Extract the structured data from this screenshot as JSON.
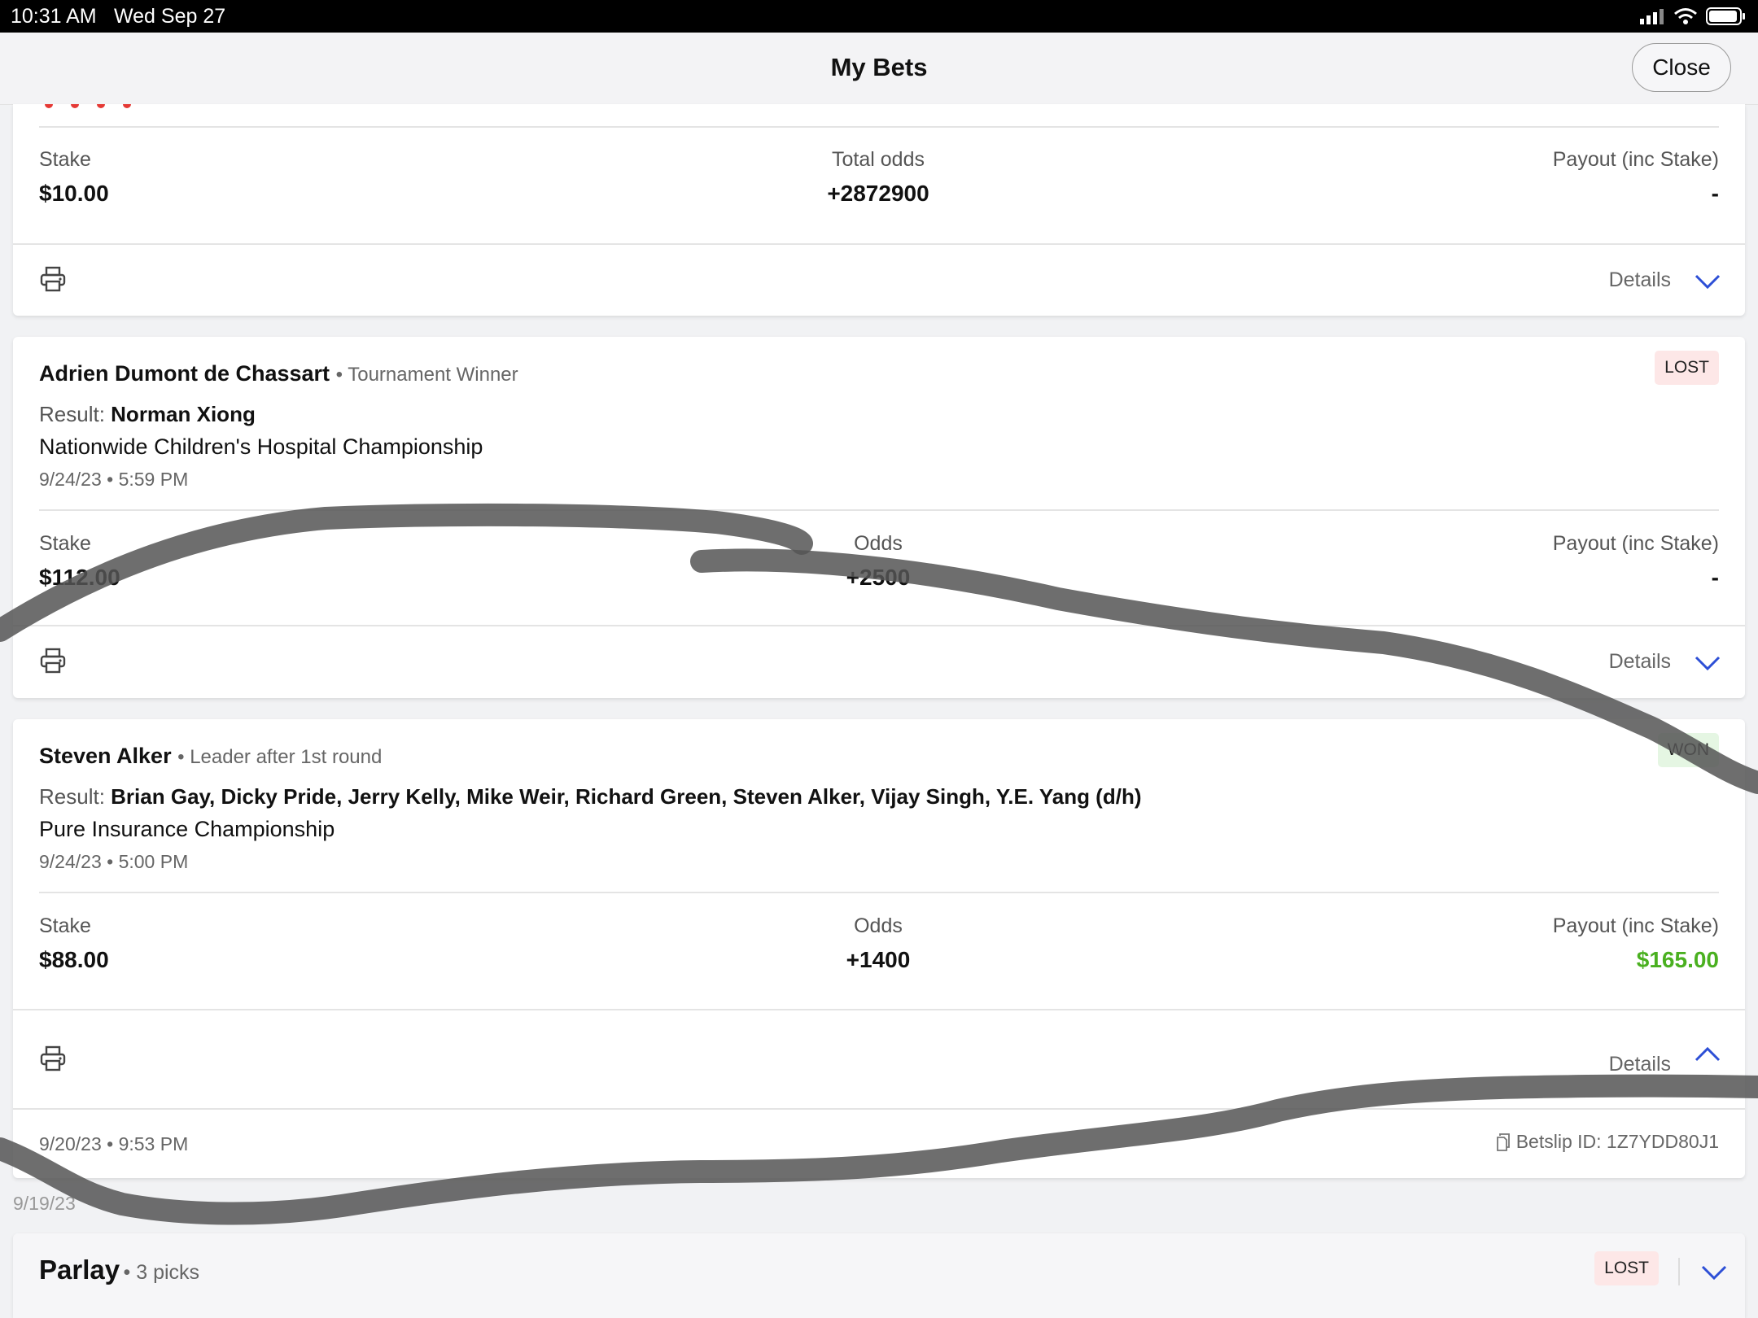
{
  "status_bar": {
    "time": "10:31 AM",
    "date": "Wed Sep 27"
  },
  "header": {
    "title": "My Bets",
    "close_label": "Close"
  },
  "card_top": {
    "stake_label": "Stake",
    "stake_value": "$10.00",
    "odds_label": "Total odds",
    "odds_value": "+2872900",
    "payout_label": "Payout (inc Stake)",
    "payout_value": "-",
    "details_label": "Details"
  },
  "bets": [
    {
      "selection": "Adrien Dumont de Chassart",
      "market": "Tournament Winner",
      "status": "LOST",
      "result_label": "Result:",
      "result_value": "Norman Xiong",
      "event": "Nationwide Children's Hospital Championship",
      "datetime": "9/24/23 • 5:59 PM",
      "stake_label": "Stake",
      "stake_value": "$112.00",
      "odds_label": "Odds",
      "odds_value": "+2500",
      "payout_label": "Payout (inc Stake)",
      "payout_value": "-",
      "details_label": "Details"
    },
    {
      "selection": "Steven Alker",
      "market": "Leader after 1st round",
      "status": "WON",
      "result_label": "Result:",
      "result_value": "Brian Gay, Dicky Pride, Jerry Kelly, Mike Weir, Richard Green, Steven Alker, Vijay Singh, Y.E. Yang (d/h)",
      "event": "Pure Insurance Championship",
      "datetime": "9/24/23 • 5:00 PM",
      "stake_label": "Stake",
      "stake_value": "$88.00",
      "odds_label": "Odds",
      "odds_value": "+1400",
      "payout_label": "Payout (inc Stake)",
      "payout_value": "$165.00",
      "details_label": "Details",
      "placed_datetime": "9/20/23 • 9:53 PM",
      "betslip_label": "Betslip ID: 1Z7YDD80J1"
    }
  ],
  "date_separator": "9/19/23",
  "parlay": {
    "title": "Parlay",
    "picks": "3 picks",
    "status": "LOST"
  },
  "colors": {
    "won_green": "#4ab020",
    "chevron_blue": "#2d4fd6",
    "lost_bg": "#fde7e7"
  }
}
